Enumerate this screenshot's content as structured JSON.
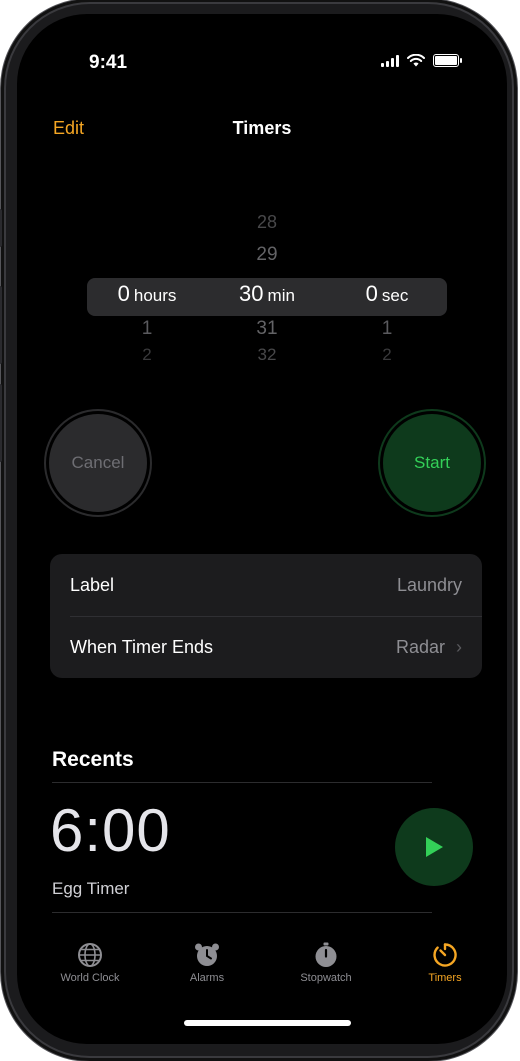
{
  "status_bar": {
    "time": "9:41"
  },
  "nav": {
    "edit_label": "Edit",
    "title": "Timers"
  },
  "picker": {
    "hours": {
      "above": [
        "",
        ""
      ],
      "selected": "0",
      "unit": "hours",
      "below": [
        "1",
        "2"
      ]
    },
    "minutes": {
      "above": [
        "28",
        "29"
      ],
      "selected": "30",
      "unit": "min",
      "below": [
        "31",
        "32"
      ]
    },
    "seconds": {
      "above": [
        "",
        ""
      ],
      "selected": "0",
      "unit": "sec",
      "below": [
        "1",
        "2"
      ]
    }
  },
  "buttons": {
    "cancel_label": "Cancel",
    "start_label": "Start"
  },
  "settings": {
    "label_title": "Label",
    "label_value": "Laundry",
    "sound_title": "When Timer Ends",
    "sound_value": "Radar"
  },
  "recents": {
    "title": "Recents",
    "items": [
      {
        "time": "6:00",
        "label": "Egg Timer"
      }
    ]
  },
  "tabbar": {
    "items": [
      {
        "label": "World Clock",
        "icon": "globe-icon"
      },
      {
        "label": "Alarms",
        "icon": "alarm-clock-icon"
      },
      {
        "label": "Stopwatch",
        "icon": "stopwatch-icon"
      },
      {
        "label": "Timers",
        "icon": "timer-icon"
      }
    ],
    "active": "Timers"
  },
  "colors": {
    "accent": "#f5a623",
    "start_green": "#33d058",
    "background": "#000000"
  }
}
